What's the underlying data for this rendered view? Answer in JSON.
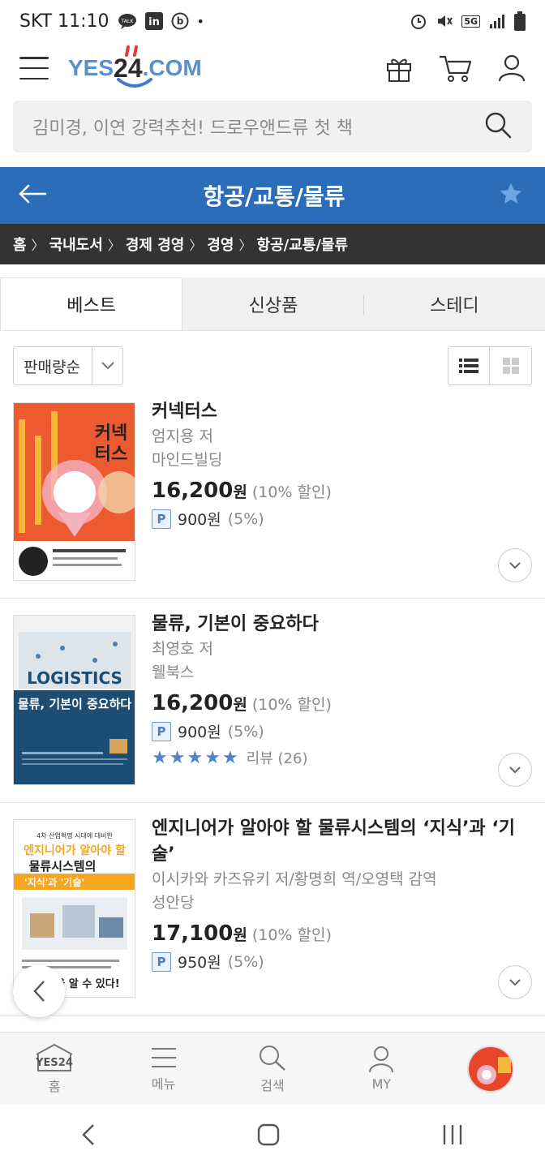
{
  "status": {
    "carrier_time": "SKT 11:10",
    "dot": "•",
    "network": "5G"
  },
  "header": {
    "logo_yes": "YES",
    "logo_num": "24",
    "logo_com": ".COM"
  },
  "search": {
    "placeholder": "김미경, 이연 강력추천! 드로우앤드류 첫 책"
  },
  "title_bar": {
    "title": "항공/교통/물류"
  },
  "breadcrumb": [
    "홈",
    "국내도서",
    "경제 경영",
    "경영",
    "항공/교통/물류"
  ],
  "breadcrumb_sep": "〉",
  "tabs": [
    "베스트",
    "신상품",
    "스테디"
  ],
  "sort": {
    "selected": "판매량순"
  },
  "books": [
    {
      "title": "커넥터스",
      "author": "엄지용 저",
      "publisher": "마인드빌딩",
      "price": "16,200",
      "won": "원",
      "discount": "(10% 할인)",
      "point_badge": "P",
      "point": "900원",
      "point_pct": "(5%)",
      "cover_text": "커넥\n터스",
      "cover_colors": [
        "#e8462a",
        "#f2c94c"
      ]
    },
    {
      "title": "물류, 기본이 중요하다",
      "author": "최영호 저",
      "publisher": "웰북스",
      "price": "16,200",
      "won": "원",
      "discount": "(10% 할인)",
      "point_badge": "P",
      "point": "900원",
      "point_pct": "(5%)",
      "rating_stars": 5,
      "review": "리뷰 (26)",
      "cover_head": "LOGISTICS",
      "cover_sub": "물류, 기본이 중요하다",
      "cover_colors": [
        "#1e4d73",
        "#f2f2f2"
      ]
    },
    {
      "title": "엔지니어가 알아야 할 물류시스템의 ‘지식’과 ‘기술’",
      "author": "이시카와 카즈유키 저/황명희 역/오영택 감역",
      "publisher": "성안당",
      "price": "17,100",
      "won": "원",
      "discount": "(10% 할인)",
      "point_badge": "P",
      "point": "950원",
      "point_pct": "(5%)",
      "cover_top": "4차 산업혁명 시대에 대비한",
      "cover_line1": "엔지니어가 알아야 할",
      "cover_line2": "물류시스템의",
      "cover_line3": "'지식'과 '기술'",
      "cover_bottom": "것을 알 수 있다!",
      "cover_colors": [
        "#f5a623",
        "#ffffff"
      ]
    }
  ],
  "bottom_nav": [
    {
      "label": "홈",
      "icon": "yes24-home-icon"
    },
    {
      "label": "메뉴",
      "icon": "menu-icon"
    },
    {
      "label": "검색",
      "icon": "search-icon"
    },
    {
      "label": "MY",
      "icon": "user-icon"
    }
  ],
  "bottom_nav_logo": "YES24",
  "colors": {
    "brand_blue": "#2b6db8",
    "breadcrumb_bg": "#333333",
    "star_blue": "#4a86c8"
  }
}
